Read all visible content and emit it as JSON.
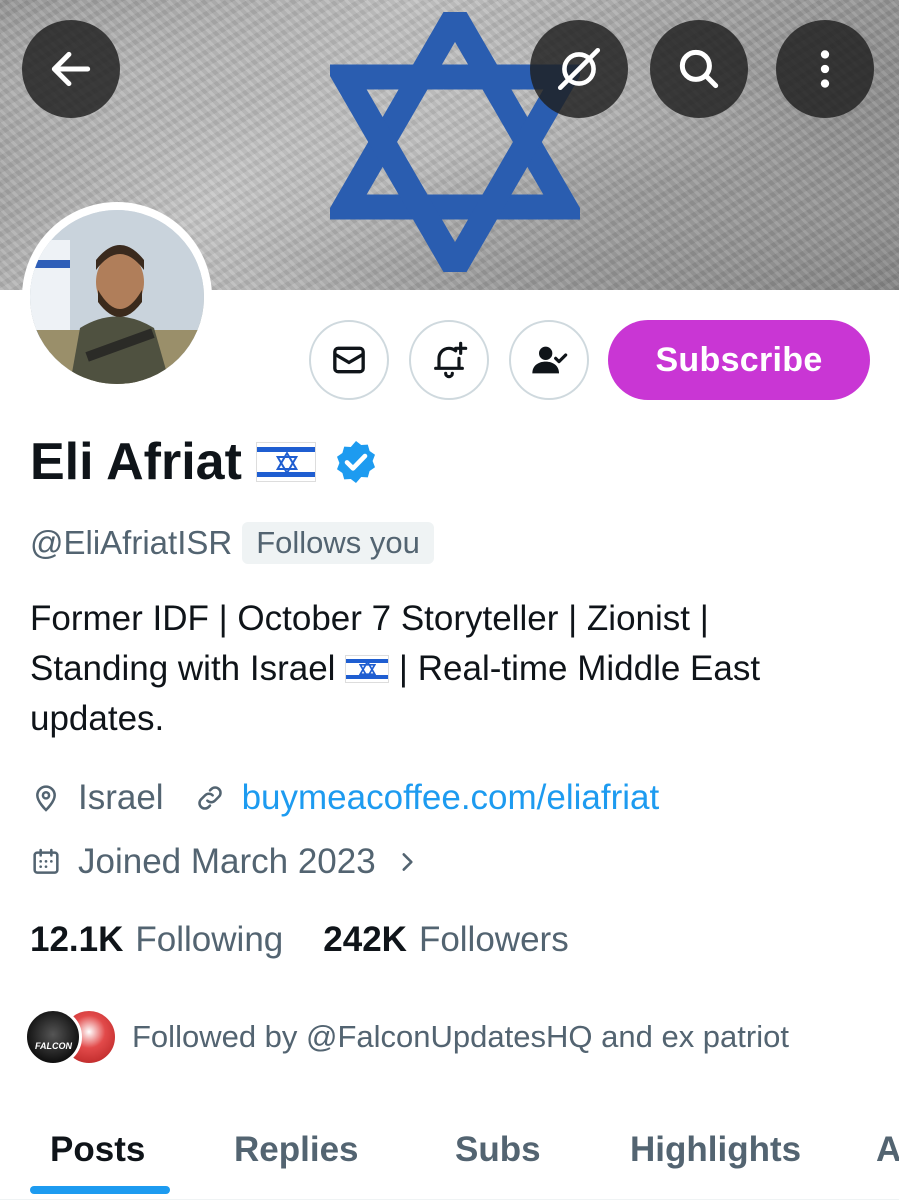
{
  "profile": {
    "name": "Eli Afriat",
    "handle": "@EliAfriatISR",
    "follows_you": "Follows you",
    "bio_line1": "Former IDF | October 7 Storyteller | Zionist |",
    "bio_line2a": "Standing with Israel",
    "bio_line2b": "| Real-time Middle East",
    "bio_line3": "updates.",
    "location": "Israel",
    "website": "buymeacoffee.com/eliafriat",
    "joined": "Joined March 2023",
    "following_count": "12.1K",
    "following_label": "Following",
    "followers_count": "242K",
    "followers_label": "Followers",
    "followed_by": "Followed by @FalconUpdatesHQ and ex patriot",
    "followed_avatar_text": "FALCON",
    "verified_color": "#1d9bf0"
  },
  "actions": {
    "subscribe_label": "Subscribe",
    "subscribe_color": "#c936d4",
    "icons": [
      "back-arrow-icon",
      "grok-icon",
      "search-icon",
      "more-vertical-icon",
      "mail-icon",
      "bell-plus-icon",
      "user-check-icon"
    ]
  },
  "tabs": {
    "items": [
      "Posts",
      "Replies",
      "Subs",
      "Highlights",
      "A"
    ],
    "active": "Posts"
  }
}
